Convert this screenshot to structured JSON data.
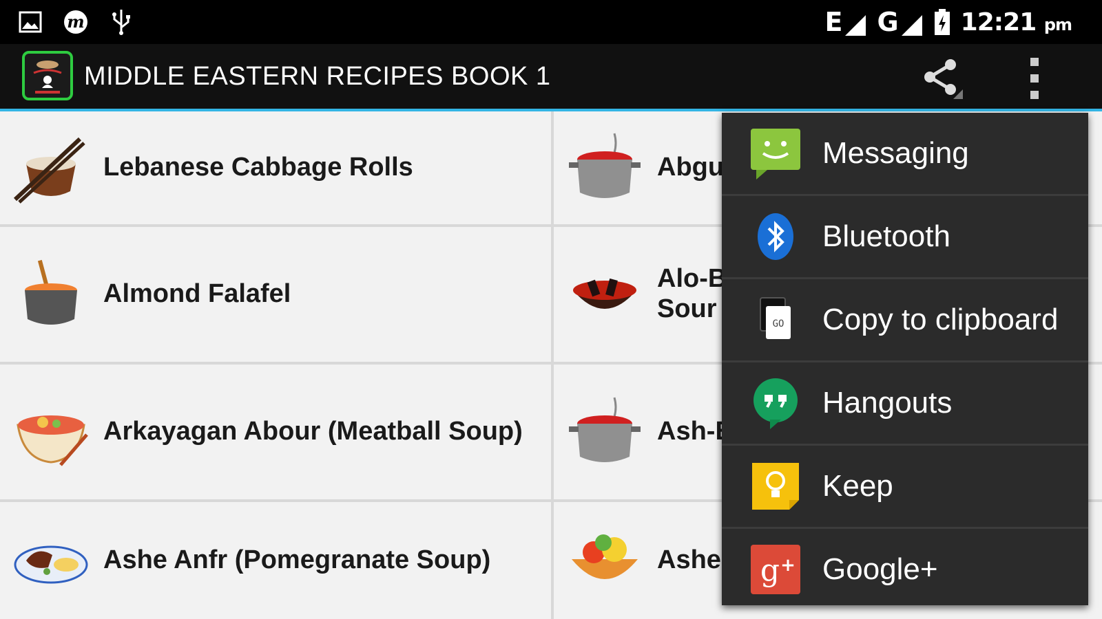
{
  "status_bar": {
    "left_icons": [
      "gallery-icon",
      "m-app-icon",
      "usb-icon"
    ],
    "network_1": "E",
    "network_2": "G",
    "time": "12:21",
    "ampm": "pm"
  },
  "action_bar": {
    "title": "MIDDLE EASTERN RECIPES BOOK 1",
    "logo_icon": "chef-logo-icon",
    "share_icon": "share-icon",
    "overflow_icon": "overflow-menu-icon"
  },
  "recipes": {
    "left": [
      {
        "label": "Lebanese Cabbage Rolls",
        "icon": "bowl-chopsticks-icon"
      },
      {
        "label": "Almond Falafel",
        "icon": "pot-icon"
      },
      {
        "label": "Arkayagan Abour (Meatball Soup)",
        "icon": "noodle-bowl-icon"
      },
      {
        "label": "Ashe Anfr (Pomegranate Soup)",
        "icon": "plate-icon"
      }
    ],
    "right": [
      {
        "line1": "Abgu",
        "line2": "",
        "icon": "cooking-pot-icon"
      },
      {
        "line1": "Alo-B",
        "line2": "Sour",
        "icon": "grill-wok-icon"
      },
      {
        "line1": "Ash-E",
        "line2": "",
        "icon": "cooking-pot-icon"
      },
      {
        "line1": "Ashe",
        "line2": "",
        "icon": "fruit-basket-icon"
      }
    ]
  },
  "share_menu": {
    "items": [
      {
        "label": "Messaging",
        "icon": "messaging-icon"
      },
      {
        "label": "Bluetooth",
        "icon": "bluetooth-icon"
      },
      {
        "label": "Copy to clipboard",
        "icon": "clipboard-icon"
      },
      {
        "label": "Hangouts",
        "icon": "hangouts-icon"
      },
      {
        "label": "Keep",
        "icon": "keep-icon"
      },
      {
        "label": "Google+",
        "icon": "google-plus-icon"
      }
    ]
  },
  "colors": {
    "accent": "#33b5e5",
    "logo_border": "#2ecc40",
    "menu_bg": "#2b2b2b"
  }
}
